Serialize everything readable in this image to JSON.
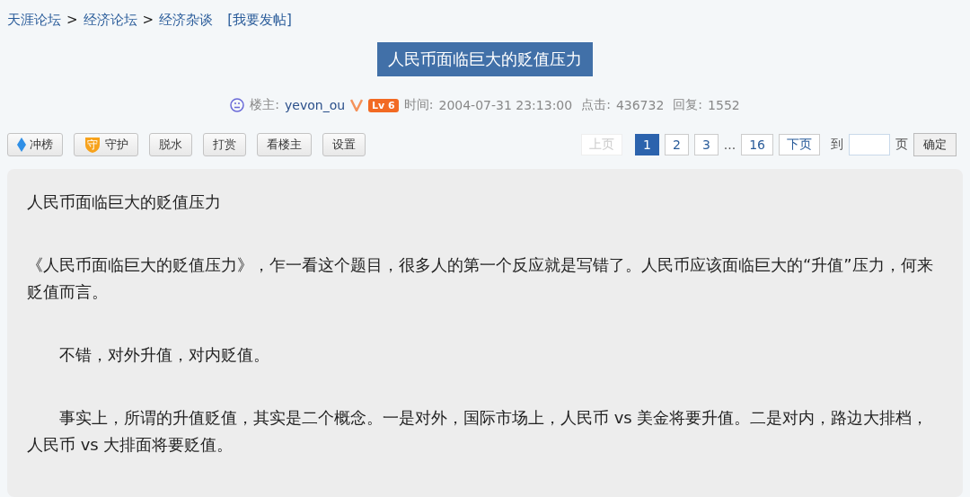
{
  "breadcrumb": {
    "links": [
      "天涯论坛",
      "经济论坛",
      "经济杂谈"
    ],
    "separator": ">",
    "post_link": "[我要发帖]"
  },
  "title": "人民币面临巨大的贬值压力",
  "meta": {
    "author_label": "楼主:",
    "author": "yevon_ou",
    "level": "Lv 6",
    "time_label": "时间:",
    "time": "2004-07-31 23:13:00",
    "clicks_label": "点击:",
    "clicks": "436732",
    "replies_label": "回复:",
    "replies": "1552"
  },
  "actions": [
    {
      "label": "冲榜",
      "kind": "diamond"
    },
    {
      "label": "守护",
      "kind": "shield",
      "icon_text": "守"
    },
    {
      "label": "脱水",
      "kind": "plain"
    },
    {
      "label": "打赏",
      "kind": "plain"
    },
    {
      "label": "看楼主",
      "kind": "plain"
    },
    {
      "label": "设置",
      "kind": "plain"
    }
  ],
  "pagination": {
    "items": [
      {
        "label": "上页",
        "kind": "link",
        "disabled": true,
        "selected": false
      },
      {
        "label": "1",
        "kind": "link",
        "disabled": false,
        "selected": true
      },
      {
        "label": "2",
        "kind": "link",
        "disabled": false,
        "selected": false
      },
      {
        "label": "3",
        "kind": "link",
        "disabled": false,
        "selected": false
      },
      {
        "label": "...",
        "kind": "ellipsis"
      },
      {
        "label": "16",
        "kind": "link",
        "disabled": false,
        "selected": false
      },
      {
        "label": "下页",
        "kind": "link",
        "disabled": false,
        "selected": false
      }
    ],
    "goto_label": "到",
    "page_label": "页",
    "confirm": "确定"
  },
  "post": {
    "paragraphs": [
      {
        "text": "人民币面临巨大的贬值压力",
        "indented": false
      },
      {
        "text": "《人民币面临巨大的贬值压力》，乍一看这个题目，很多人的第一个反应就是写错了。人民币应该面临巨大的“升值”压力，何来贬值而言。",
        "indented": false
      },
      {
        "text": "不错，对外升值，对内贬值。",
        "indented": true
      },
      {
        "text": "事实上，所谓的升值贬值，其实是二个概念。一是对外，国际市场上，人民币 vs 美金将要升值。二是对内，路边大排档，人民币 vs 大排面将要贬值。",
        "indented": true
      }
    ]
  }
}
